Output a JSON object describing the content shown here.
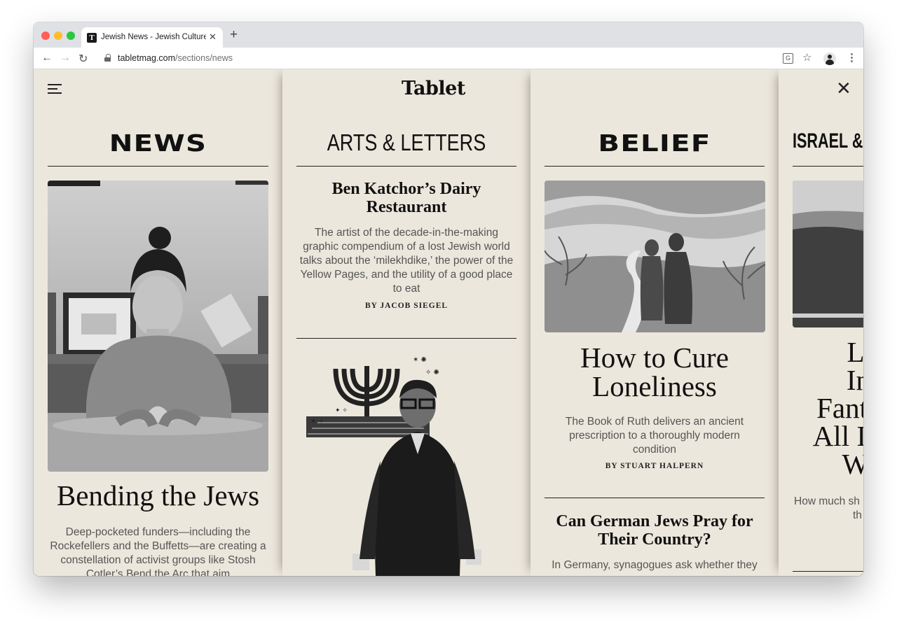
{
  "browser": {
    "tab_title": "Jewish News - Jewish Culture",
    "favicon_letter": "T",
    "url_host": "tabletmag.com",
    "url_path": "/sections/news"
  },
  "site": {
    "logo": "Tablet"
  },
  "sections": [
    {
      "title": "NEWS",
      "story": {
        "headline": "Bending the Jews",
        "dek": "Deep-pocketed funders—including the Rockefellers and the Buffetts—are creating a constellation of activist groups like Stosh Cotler’s Bend the Arc that aim"
      }
    },
    {
      "title": "ARTS & LETTERS",
      "story": {
        "headline": "Ben Katchor’s Dairy Restaurant",
        "dek": "The artist of the decade-in-the-making graphic compendium of a lost Jewish world talks about the ‘milekhdike,’ the power of the Yellow Pages, and the utility of a good place to eat",
        "byline": "BY JACOB SIEGEL"
      }
    },
    {
      "title": "BELIEF",
      "story": {
        "headline": "How to Cure Loneliness",
        "dek": "The Book of Ruth delivers an ancient prescription to a thoroughly modern condition",
        "byline": "BY STUART HALPERN"
      },
      "story2": {
        "headline": "Can German Jews Pray for Their Country?",
        "dek": "In Germany, synagogues ask whether they"
      }
    },
    {
      "title": "ISRAEL &",
      "story": {
        "headline_lines": [
          "Lo",
          "In",
          "Fant",
          "All I",
          "Wi"
        ],
        "dek_lines": [
          "How much sh",
          "th"
        ]
      }
    }
  ]
}
